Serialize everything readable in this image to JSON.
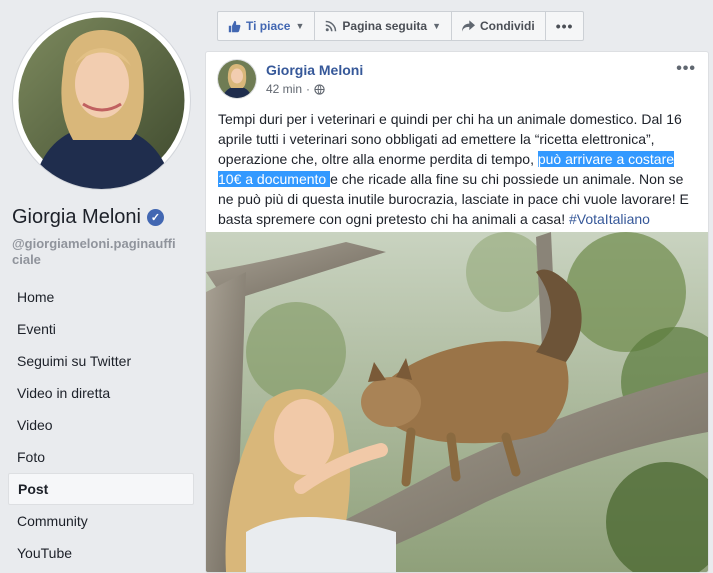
{
  "sidebar": {
    "page_name": "Giorgia Meloni",
    "username": "@giorgiameloni.paginaufficiale",
    "nav": [
      {
        "label": "Home"
      },
      {
        "label": "Eventi"
      },
      {
        "label": "Seguimi su Twitter"
      },
      {
        "label": "Video in diretta"
      },
      {
        "label": "Video"
      },
      {
        "label": "Foto"
      },
      {
        "label": "Post",
        "active": true
      },
      {
        "label": "Community"
      },
      {
        "label": "YouTube"
      }
    ]
  },
  "actions": {
    "like_label": "Ti piace",
    "follow_label": "Pagina seguita",
    "share_label": "Condividi"
  },
  "post": {
    "author": "Giorgia Meloni",
    "time": "42 min",
    "text_before": "Tempi duri per i veterinari e quindi per chi ha un animale domestico. Dal 16 aprile tutti i veterinari sono obbligati ad emettere la “ricetta elettronica”, operazione che, oltre alla enorme perdita di tempo, ",
    "text_highlight": "può arrivare a costare 10€ a documento ",
    "text_after": "e che ricade alla fine su chi possiede un animale. Non se ne può più di questa inutile burocrazia, lasciate in pace chi vuole lavorare! E basta spremere con ogni pretesto chi ha animali a casa! ",
    "hashtag": "#VotaItaliano"
  },
  "colors": {
    "brand": "#4267b2",
    "link": "#365899",
    "highlight": "#3399ff"
  }
}
